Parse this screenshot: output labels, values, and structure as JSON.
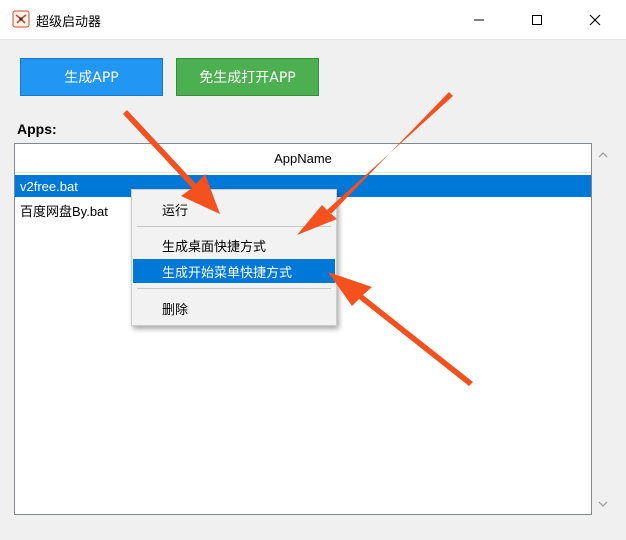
{
  "window": {
    "title": "超级启动器"
  },
  "toolbar": {
    "generate_label": "生成APP",
    "generate_open_label": "免生成打开APP"
  },
  "apps": {
    "label": "Apps:",
    "column_header": "AppName",
    "rows": [
      {
        "name": "v2free.bat",
        "selected": true
      },
      {
        "name": "百度网盘By.bat",
        "selected": false
      }
    ]
  },
  "context_menu": {
    "items": [
      {
        "label": "运行"
      },
      {
        "label": "生成桌面快捷方式"
      },
      {
        "label": "生成开始菜单快捷方式",
        "highlighted": true
      },
      {
        "label": "删除"
      }
    ]
  },
  "colors": {
    "generate_button": "#2196f3",
    "open_button": "#4caf50",
    "selection": "#0078d7",
    "annotation_arrow": "#f4511e"
  },
  "icons": {
    "app": "app-logo-icon",
    "minimize": "minimize-icon",
    "maximize": "maximize-icon",
    "close": "close-icon",
    "scroll_up": "chevron-up-icon",
    "scroll_down": "chevron-down-icon"
  }
}
